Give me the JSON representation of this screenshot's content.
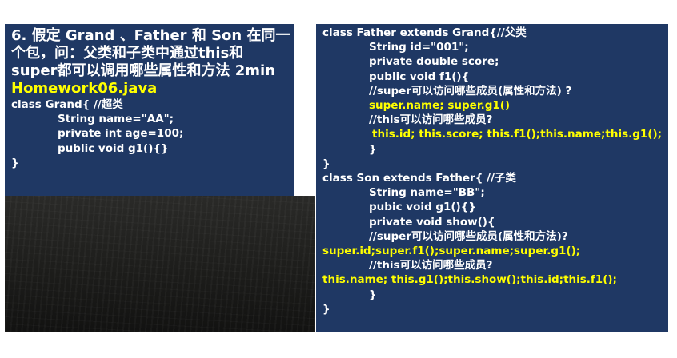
{
  "left": {
    "question_lines": [
      "6. 假定 Grand 、Father 和 Son 在同一",
      "个包，问：父类和子类中通过this和",
      "super都可以调用哪些属性和方法 2min"
    ],
    "homework_file": "Homework06.java",
    "code_lines": [
      "class Grand{ //超类",
      "String name=\"AA\";",
      "private int age=100;",
      "public void g1(){}",
      "}"
    ]
  },
  "right": {
    "father_lines": [
      "class Father extends Grand{//父类",
      "String id=\"001\";",
      "private double score;",
      "public void f1(){",
      "//super可以访问哪些成员(属性和方法) ?",
      "super.name; super.g1()",
      "//this可以访问哪些成员?",
      "this.id; this.score; this.f1();this.name;this.g1();",
      "}",
      "}"
    ],
    "son_lines": [
      "class Son extends Father{ //子类",
      "String name=\"BB\";",
      "pubic void g1(){}",
      "private void show(){",
      "//super可以访问哪些成员(属性和方法)?",
      "super.id;super.f1();super.name;super.g1();",
      "//this可以访问哪些成员?",
      "this.name; this.g1();this.show();this.id;this.f1();",
      "}",
      "}"
    ]
  },
  "colors": {
    "panel": "#1f3864",
    "highlight": "#ffff00",
    "text": "#ffffff"
  }
}
